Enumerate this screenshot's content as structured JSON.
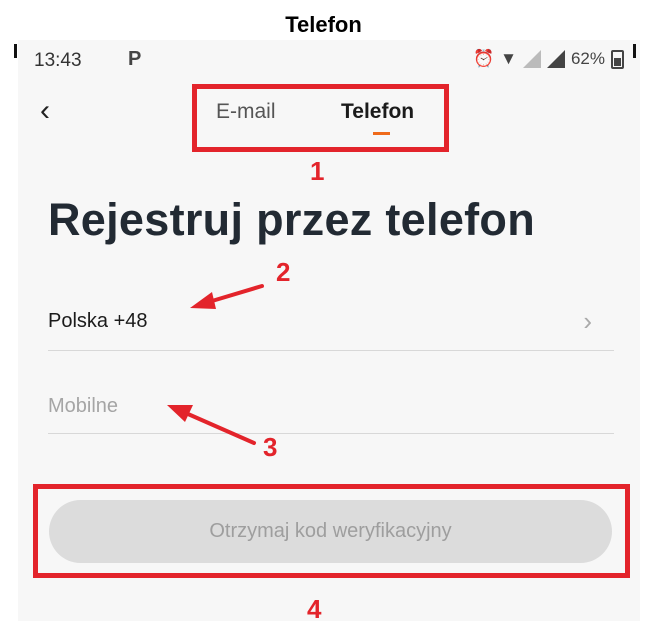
{
  "caption": "Telefon",
  "status_bar": {
    "time": "13:43",
    "notification_icon": "P",
    "alarm_icon": "alarm-clock-icon",
    "wifi_icon": "wifi-icon",
    "battery": "62%"
  },
  "header": {
    "back_icon": "back-chevron-icon",
    "tabs": [
      {
        "label": "E-mail",
        "active": false
      },
      {
        "label": "Telefon",
        "active": true
      }
    ]
  },
  "page_title": "Rejestruj przez telefon",
  "form": {
    "country": "Polska +48",
    "mobile_placeholder": "Mobilne",
    "mobile_value": ""
  },
  "button": {
    "label": "Otrzymaj kod weryfikacyjny"
  },
  "annotations": {
    "n1": "1",
    "n2": "2",
    "n3": "3",
    "n4": "4"
  },
  "colors": {
    "annotation_red": "#e3242b",
    "tab_accent": "#ef6a1a",
    "button_disabled": "#dcdcdc"
  }
}
